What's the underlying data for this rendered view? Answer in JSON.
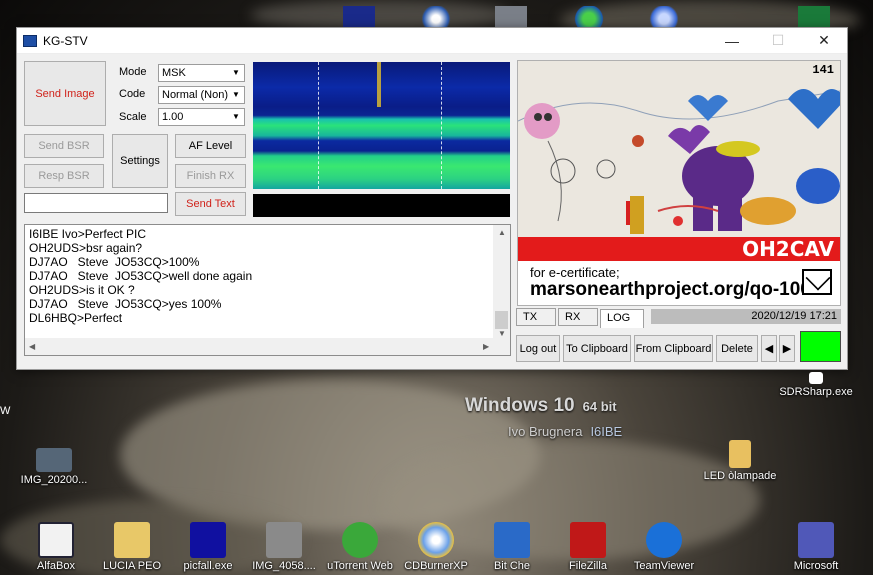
{
  "window": {
    "title": "KG-STV",
    "controls": {
      "minimize": "—",
      "maximize": "☐",
      "close": "✕"
    }
  },
  "left_panel": {
    "send_image": "Send Image",
    "mode_label": "Mode",
    "mode_value": "MSK",
    "code_label": "Code",
    "code_value": "Normal (Non)",
    "scale_label": "Scale",
    "scale_value": "1.00",
    "send_bsr": "Send BSR",
    "resp_bsr": "Resp BSR",
    "settings": "Settings",
    "af_level": "AF Level",
    "finish_rx": "Finish RX",
    "send_text": "Send Text",
    "text_input_value": ""
  },
  "log_lines": [
    "I6IBE Ivo>Perfect PIC",
    "OH2UDS>bsr again?",
    "DJ7AO   Steve  JO53CQ>100%",
    "DJ7AO   Steve  JO53CQ>well done again",
    "OH2UDS>is it OK ?",
    "DJ7AO   Steve  JO53CQ>yes 100%",
    "DL6HBQ>Perfect"
  ],
  "image_panel": {
    "image_number": "141",
    "callsign": "OH2CAV",
    "cert_line1": "for e-certificate;",
    "cert_line2": "marsonearthproject.org/qo-100"
  },
  "tabs": {
    "tx": "TX",
    "rx": "RX",
    "log": "LOG"
  },
  "datetime": "2020/12/19 17:21",
  "bottom_buttons": {
    "log_out": "Log out",
    "to_clipboard": "To Clipboard",
    "from_clipboard": "From Clipboard",
    "delete": "Delete",
    "prev": "◀",
    "next": "▶"
  },
  "desktop": {
    "win_title": "Windows 10",
    "win_bits": "64 bit",
    "owner_name": "Ivo Brugnera",
    "owner_call": "I6IBE",
    "edge_letter": "W",
    "icons": {
      "img_2020": "IMG_20200...",
      "led": "LED òlampade",
      "sdrsharp": "SDRSharp.exe",
      "alfabox": "AlfaBox",
      "lucia": "LUCIA PEO",
      "picfall": "picfall.exe",
      "img_4058": "IMG_4058....",
      "utorrent": "uTorrent Web",
      "cdburner": "CDBurnerXP",
      "bitche": "Bit Che",
      "filezilla": "FileZilla",
      "teamviewer": "TeamViewer",
      "microsoft": "Microsoft"
    }
  }
}
